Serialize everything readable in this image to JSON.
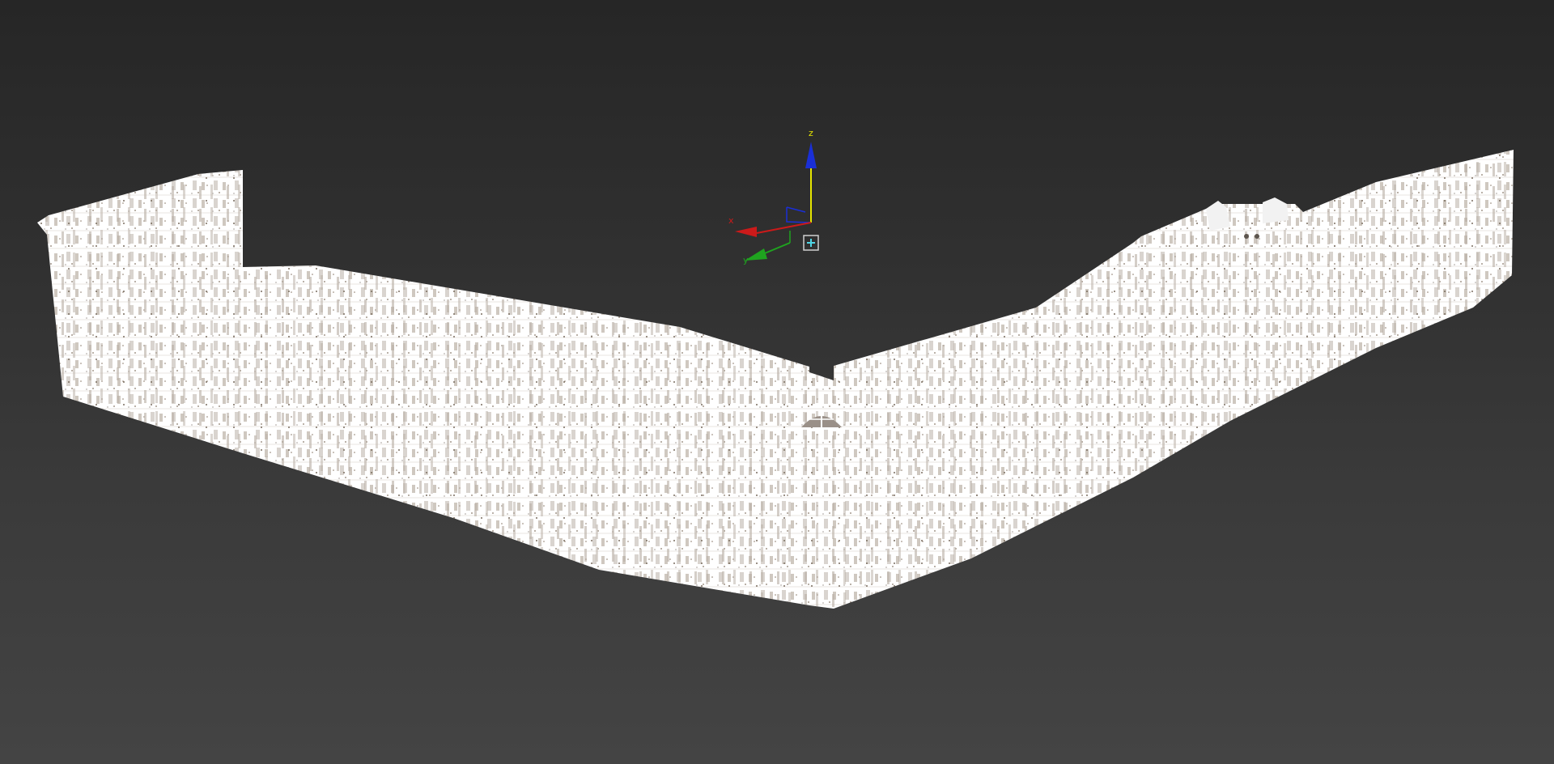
{
  "viewport": {
    "background_top": "#262626",
    "background_bottom": "#444444"
  },
  "gizmo": {
    "x_label": "x",
    "y_label": "y",
    "z_label": "z",
    "x_color": "#cc1a1a",
    "y_color": "#1fa31f",
    "z_color": "#1a2fd6",
    "z_shaft_color": "#e6e600",
    "center_box_color": "#4fd6e6",
    "icon": "move-transform-gizmo-icon"
  },
  "point_cloud": {
    "object": "building-facade-point-cloud",
    "point_color": "#ffffff",
    "detail_color": "#8a7a6a"
  }
}
